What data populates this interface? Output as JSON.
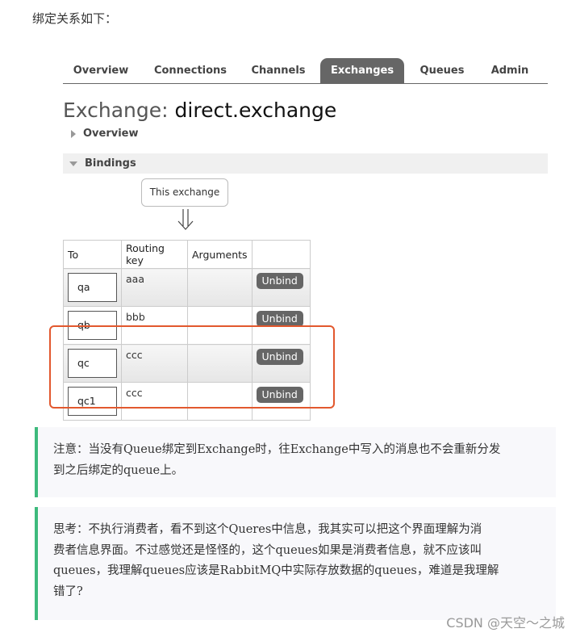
{
  "intro_text": "绑定关系如下：",
  "tabs": [
    {
      "label": "Overview",
      "active": false
    },
    {
      "label": "Connections",
      "active": false
    },
    {
      "label": "Channels",
      "active": false
    },
    {
      "label": "Exchanges",
      "active": true
    },
    {
      "label": "Queues",
      "active": false
    },
    {
      "label": "Admin",
      "active": false
    }
  ],
  "exchange": {
    "title_prefix": "Exchange:",
    "title_name": "direct.exchange"
  },
  "sections": {
    "overview": "Overview",
    "bindings": "Bindings"
  },
  "this_exchange": "This exchange",
  "bindings_table": {
    "headers": [
      "To",
      "Routing key",
      "Arguments",
      ""
    ],
    "rows": [
      {
        "to": "qa",
        "routing_key": "aaa",
        "arguments": "",
        "action": "Unbind"
      },
      {
        "to": "qb",
        "routing_key": "bbb",
        "arguments": "",
        "action": "Unbind"
      },
      {
        "to": "qc",
        "routing_key": "ccc",
        "arguments": "",
        "action": "Unbind"
      },
      {
        "to": "qc1",
        "routing_key": "ccc",
        "arguments": "",
        "action": "Unbind"
      }
    ]
  },
  "notes": {
    "note1": {
      "line1": "注意：当没有Queue绑定到Exchange时，往Exchange中写入的消息也不会重新分发",
      "line2": "到之后绑定的queue上。"
    },
    "note2": {
      "line1": "思考：不执行消费者，看不到这个Queres中信息，我其实可以把这个界面理解为消",
      "line2": "费者信息界面。不过感觉还是怪怪的，这个queues如果是消费者信息，就不应该叫",
      "line3": "queues，我理解queues应该是RabbitMQ中实际存放数据的queues，难道是我理解",
      "line4": "错了?"
    }
  },
  "watermark": "CSDN @天空～之城",
  "colors": {
    "tab_active_bg": "#666666",
    "highlight_border": "#e2582e",
    "note_border": "#3dba7c",
    "unbind_bg": "#666666"
  }
}
